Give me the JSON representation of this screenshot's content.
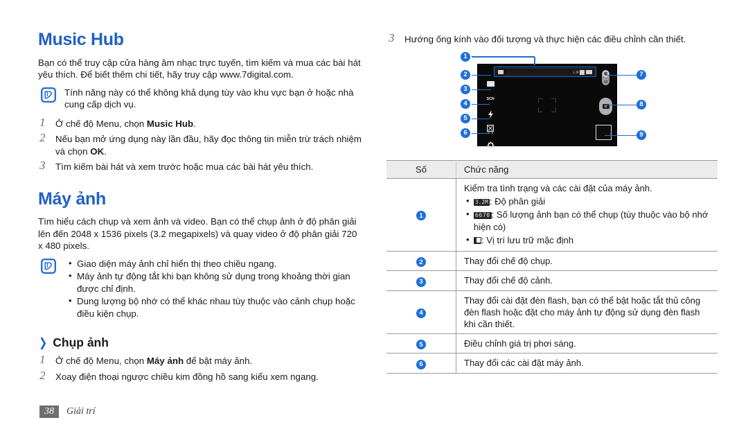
{
  "left": {
    "music_hub": {
      "title": "Music Hub",
      "intro": "Bạn có thể truy cập cửa hàng âm nhạc trực tuyến, tìm kiếm và mua các bài hát yêu thích. Để biết thêm chi tiết, hãy truy cập www.7digital.com.",
      "note": "Tính năng này có thể không khả dụng tùy vào khu vực bạn ở hoặc nhà cung cấp dịch vụ.",
      "steps": [
        {
          "num": "1",
          "pre": "Ở chế độ Menu, chọn ",
          "bold": "Music Hub",
          "post": "."
        },
        {
          "num": "2",
          "pre": "Nếu bạn mở ứng dụng này lần đầu, hãy đọc thông tin miễn trừ trách nhiệm và chọn ",
          "bold": "OK",
          "post": "."
        },
        {
          "num": "3",
          "pre": "Tìm kiếm bài hát và xem trước hoặc mua các bài hát yêu thích.",
          "bold": "",
          "post": ""
        }
      ]
    },
    "camera": {
      "title": "Máy ảnh",
      "intro": "Tìm hiểu cách chụp và xem ảnh và video. Bạn có thể chụp ảnh ở độ phân giải lên đến 2048 x 1536 pixels (3.2 megapixels) và quay video ở độ phân giải 720 x 480 pixels.",
      "notes": [
        "Giao diện máy ảnh chỉ hiển thị theo chiều ngang.",
        "Máy ảnh tự động tắt khi bạn không sử dụng trong khoảng thời gian được chỉ định.",
        "Dung lượng bộ nhớ có thể khác nhau tùy thuộc vào cảnh chụp hoặc điều kiện chụp."
      ],
      "subsection": "Chụp ảnh",
      "chevron": "❯",
      "steps": [
        {
          "num": "1",
          "pre": "Ở chế độ Menu, chọn ",
          "bold": "Máy ảnh",
          "post": " để bật máy ảnh."
        },
        {
          "num": "2",
          "pre": "Xoay điện thoại ngược chiều kim đồng hồ sang kiểu xem ngang.",
          "bold": "",
          "post": ""
        }
      ]
    }
  },
  "right": {
    "step": {
      "num": "3",
      "text": "Hướng ống kính vào đối tượng và thực hiện các điều chỉnh cần thiết."
    },
    "diagram": {
      "callouts": [
        "1",
        "2",
        "3",
        "4",
        "5",
        "6",
        "7",
        "8",
        "9"
      ],
      "screen_icons": {
        "scene_label": "SCN",
        "exposure_value": "0.0",
        "topbar_resolution": "3.2M"
      }
    },
    "table": {
      "headers": [
        "Số",
        "Chức năng"
      ],
      "rows": [
        {
          "num": "1",
          "lead": "Kiểm tra tình trạng và các cài đặt của máy ảnh.",
          "items": [
            {
              "badge": "3.2M",
              "badge_type": "res",
              "text": ": Độ phân giải"
            },
            {
              "badge": "6670",
              "badge_type": "count",
              "text": ": Số lượng ảnh bạn có thể chụp (tùy thuộc vào bộ nhớ hiện có)"
            },
            {
              "badge": "",
              "badge_type": "store",
              "text": ": Vị trí lưu trữ mặc định"
            }
          ]
        },
        {
          "num": "2",
          "lead": "Thay đổi chế độ chụp.",
          "items": []
        },
        {
          "num": "3",
          "lead": "Thay đổi chế độ cảnh.",
          "items": []
        },
        {
          "num": "4",
          "lead": "Thay đổi cài đặt đèn flash, bạn có thể bật hoặc tắt thủ công đèn flash hoặc đặt cho máy ảnh tự động sử dụng đèn flash khi cần thiết.",
          "items": []
        },
        {
          "num": "5",
          "lead": "Điều chỉnh giá trị phơi sáng.",
          "items": []
        },
        {
          "num": "6",
          "lead": "Thay đổi các cài đặt máy ảnh.",
          "items": []
        }
      ]
    }
  },
  "footer": {
    "page": "38",
    "label": "Giải trí"
  },
  "colors": {
    "accent": "#2061c4",
    "callout": "#1f6fd8",
    "footer_bg": "#6e6e6e"
  }
}
